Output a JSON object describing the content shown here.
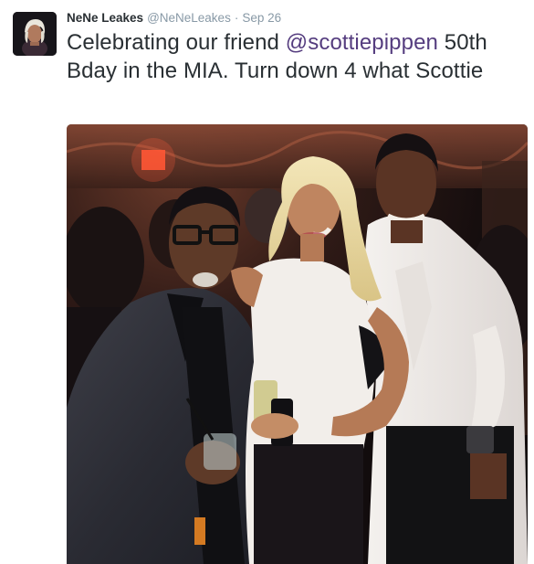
{
  "tweet": {
    "author": {
      "name": "NeNe Leakes",
      "handle": "@NeNeLeakes"
    },
    "separator": "·",
    "date": "Sep 26",
    "text_before": "Celebrating our friend ",
    "mention": "@scottiepippen",
    "text_after": " 50th Bday in the MIA. Turn down 4 what Scottie"
  },
  "colors": {
    "mention": "#553d7f",
    "meta": "#8899a6",
    "text": "#292f33"
  }
}
